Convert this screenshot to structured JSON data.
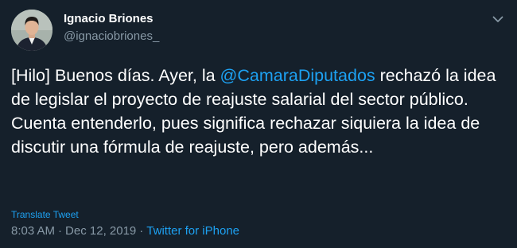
{
  "tweet": {
    "author": {
      "name": "Ignacio Briones",
      "handle": "@ignaciobriones_"
    },
    "text": {
      "before_mention": "[Hilo] Buenos días. Ayer, la ",
      "mention": "@CamaraDiputados",
      "after_mention": " rechazó la idea de legislar el proyecto de reajuste salarial del sector público. Cuenta entenderlo, pues significa rechazar siquiera la idea de discutir una fórmula de reajuste, pero además..."
    },
    "translate_label": "Translate Tweet",
    "meta": {
      "time": "8:03 AM",
      "separator1": "·",
      "date": "Dec 12, 2019",
      "separator2": "·",
      "source": "Twitter for iPhone"
    },
    "colors": {
      "background": "#15202b",
      "text": "#ffffff",
      "muted": "#8899a6",
      "accent": "#1da1f2"
    },
    "icons": {
      "more": "chevron-down-icon"
    }
  }
}
